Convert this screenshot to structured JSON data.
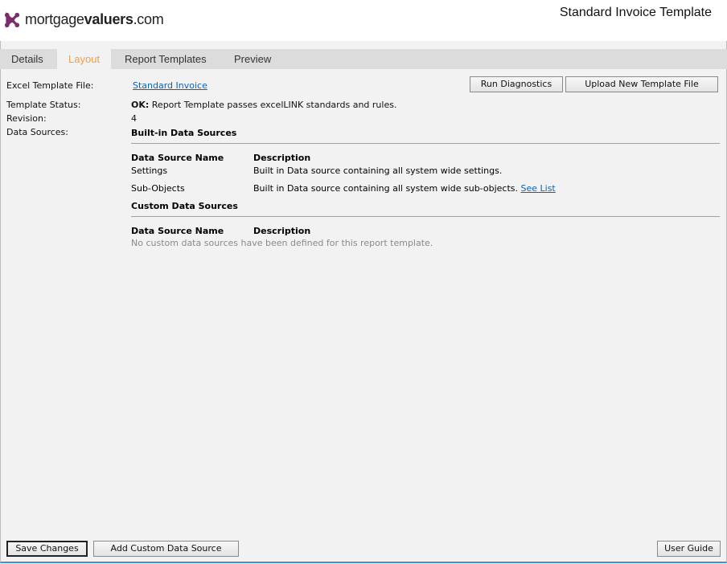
{
  "brand": {
    "name_regular": "mortgage",
    "name_bold": "valuers",
    "name_suffix": ".com",
    "logo_color": "#7a2e6a"
  },
  "page_title": "Standard Invoice Template",
  "tabs": [
    {
      "label": "Details",
      "active": false
    },
    {
      "label": "Layout",
      "active": true
    },
    {
      "label": "Report Templates",
      "active": false
    },
    {
      "label": "Preview",
      "active": false
    }
  ],
  "fields": {
    "excel_template_label": "Excel Template File:",
    "excel_template_value": "Standard Invoice",
    "status_label": "Template Status:",
    "status_ok": "OK:",
    "status_text": " Report Template passes excelLINK standards and rules.",
    "revision_label": "Revision:",
    "revision_value": "4",
    "data_sources_label": "Data Sources:"
  },
  "toolbar": {
    "run_diagnostics": "Run Diagnostics",
    "upload_template": "Upload New Template File"
  },
  "builtin": {
    "title": "Built-in Data Sources",
    "col_name": "Data Source Name",
    "col_desc": "Description",
    "rows": [
      {
        "name": "Settings",
        "desc": "Built in Data source containing all system wide settings.",
        "link": ""
      },
      {
        "name": "Sub-Objects",
        "desc": "Built in Data source containing all system wide sub-objects.",
        "link": "See List"
      }
    ]
  },
  "custom": {
    "title": "Custom Data Sources",
    "col_name": "Data Source Name",
    "col_desc": "Description",
    "empty": "No custom data sources have been defined for this report template."
  },
  "footer": {
    "save": "Save Changes",
    "add_custom": "Add Custom Data Source",
    "guide": "User Guide"
  }
}
